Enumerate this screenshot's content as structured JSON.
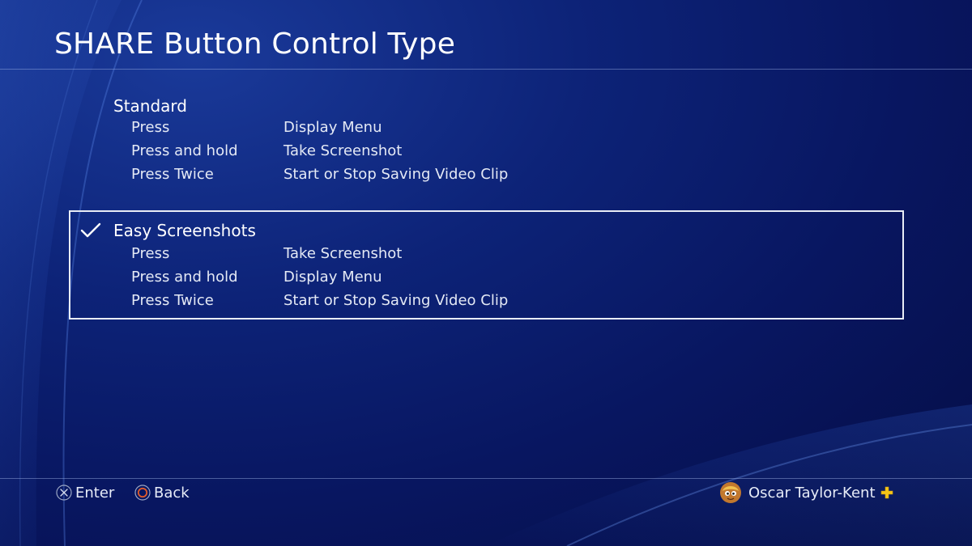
{
  "header": {
    "title": "SHARE Button Control Type"
  },
  "options": [
    {
      "label": "Standard",
      "selected": false,
      "rows": [
        {
          "action": "Press",
          "result": "Display Menu"
        },
        {
          "action": "Press and hold",
          "result": "Take Screenshot"
        },
        {
          "action": "Press Twice",
          "result": "Start or Stop Saving Video Clip"
        }
      ]
    },
    {
      "label": "Easy Screenshots",
      "selected": true,
      "rows": [
        {
          "action": "Press",
          "result": "Take Screenshot"
        },
        {
          "action": "Press and hold",
          "result": "Display Menu"
        },
        {
          "action": "Press Twice",
          "result": "Start or Stop Saving Video Clip"
        }
      ]
    }
  ],
  "footer": {
    "enter": {
      "icon": "cross-button-icon",
      "label": "Enter"
    },
    "back": {
      "icon": "circle-button-icon",
      "label": "Back"
    },
    "user": {
      "name": "Oscar Taylor-Kent",
      "avatar_icon": "user-avatar-icon",
      "status_icon": "playstation-plus-icon"
    }
  },
  "colors": {
    "background": "#081660",
    "text": "#ffffff",
    "selection_border": "#e8ecf5",
    "circle_button": "#e05a2b",
    "plus_badge": "#f5c518"
  }
}
